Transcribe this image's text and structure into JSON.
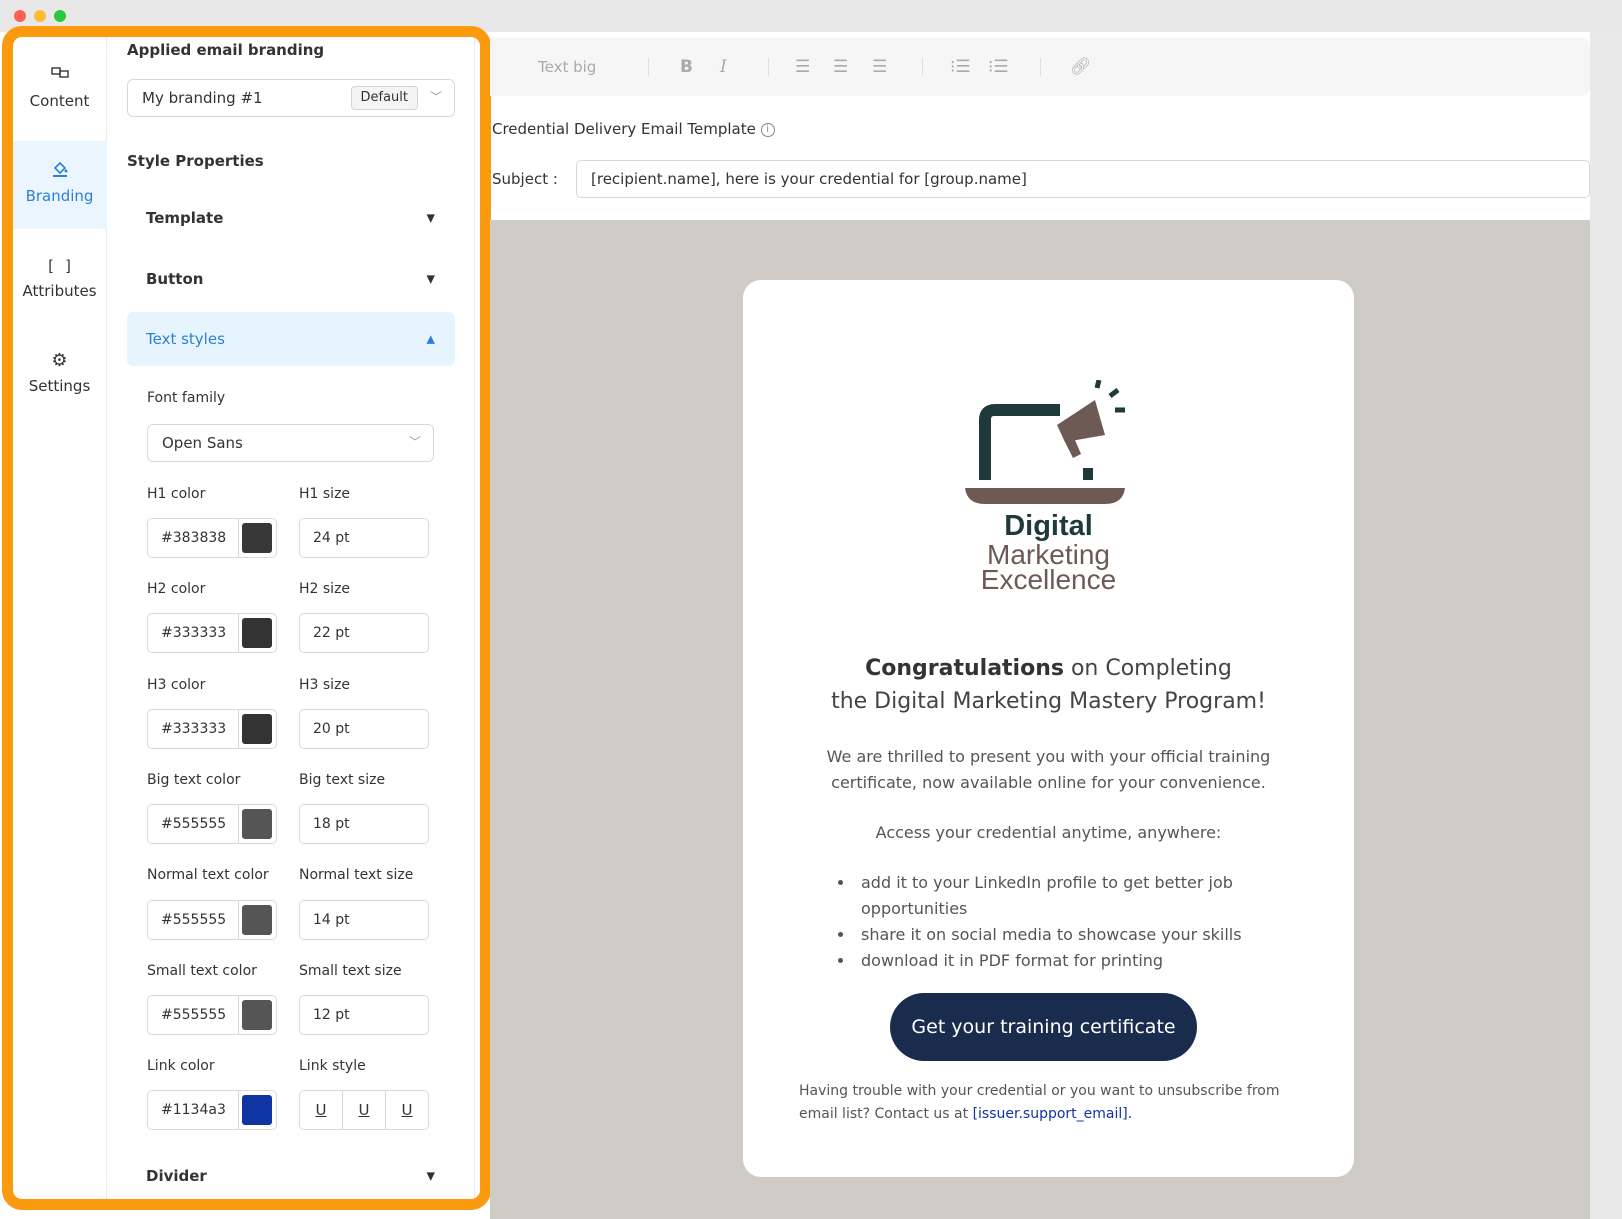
{
  "nav": {
    "items": [
      {
        "label": "Content",
        "icon": "content-icon"
      },
      {
        "label": "Branding",
        "icon": "paint-bucket-icon"
      },
      {
        "label": "Attributes",
        "icon": "brackets-icon"
      },
      {
        "label": "Settings",
        "icon": "gear-icon"
      }
    ]
  },
  "panel": {
    "applied_branding_title": "Applied email branding",
    "branding_select": "My branding #1",
    "branding_badge": "Default",
    "style_properties_title": "Style Properties",
    "sections": {
      "template": "Template",
      "button": "Button",
      "text_styles": "Text styles",
      "divider": "Divider"
    },
    "font_family_label": "Font family",
    "font_family_value": "Open Sans",
    "rows": [
      {
        "color_label": "H1 color",
        "color": "#383838",
        "size_label": "H1 size",
        "size": "24 pt"
      },
      {
        "color_label": "H2 color",
        "color": "#333333",
        "size_label": "H2 size",
        "size": "22 pt"
      },
      {
        "color_label": "H3 color",
        "color": "#333333",
        "size_label": "H3 size",
        "size": "20 pt"
      },
      {
        "color_label": "Big text color",
        "color": "#555555",
        "size_label": "Big text size",
        "size": "18 pt"
      },
      {
        "color_label": "Normal text color",
        "color": "#555555",
        "size_label": "Normal text size",
        "size": "14 pt"
      },
      {
        "color_label": "Small text color",
        "color": "#555555",
        "size_label": "Small text size",
        "size": "12 pt"
      }
    ],
    "link_color_label": "Link color",
    "link_color": "#1134a3",
    "link_style_label": "Link style",
    "link_style_options": [
      "U",
      "U",
      "U"
    ]
  },
  "editor": {
    "text_style_dropdown": "Text big",
    "template_title": "Credential Delivery Email Template",
    "subject_label": "Subject :",
    "subject_value": "[recipient.name], here is your credential for [group.name]"
  },
  "email": {
    "logo_line1": "Digital",
    "logo_line2": "Marketing",
    "logo_line3": "Excellence",
    "congrats_bold": "Congratulations",
    "congrats_rest": " on Completing",
    "congrats_line2": "the Digital Marketing Mastery Program!",
    "para1_line1": "We are thrilled to present you with your official training",
    "para1_line2": "certificate, now available online for your convenience.",
    "para2": "Access your credential anytime, anywhere:",
    "bullets": [
      "add it to your LinkedIn profile to get better job opportunities",
      "share it on social media to showcase your skills",
      "download it in PDF format for printing"
    ],
    "cta": "Get your training certificate",
    "footer_text": "Having trouble with your credential or you want to unsubscribe from email list? Contact us at ",
    "footer_link": "[issuer.support_email]."
  },
  "colors": {
    "accent": "#2f7fd6",
    "highlight_border": "#fc9a0d",
    "cta_bg": "#1a2c4e",
    "preview_bg": "#cfcbc7"
  }
}
